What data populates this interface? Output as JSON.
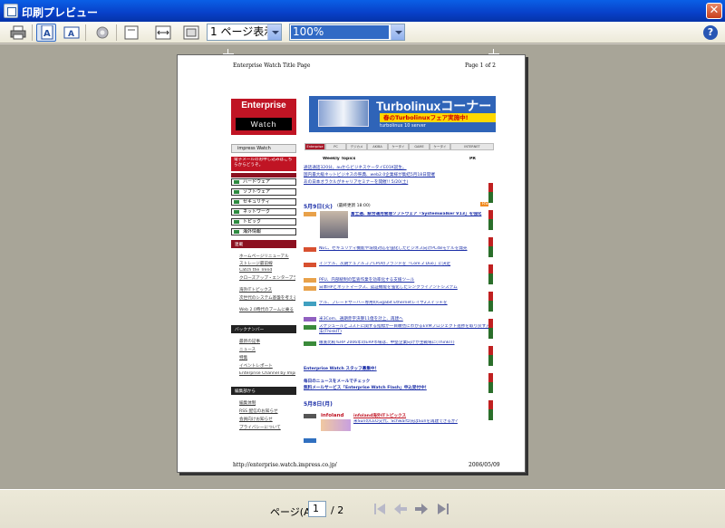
{
  "window": {
    "title": "印刷プレビュー",
    "close_symbol": "✕"
  },
  "toolbar": {
    "buttons": [
      "print-icon",
      "portrait-icon",
      "landscape-icon",
      "page-setup-gear-icon",
      "full-page-icon",
      "page-width-icon",
      "shrink-to-fit-icon"
    ],
    "view_mode": "1 ページ表示",
    "zoom": "100%",
    "help_symbol": "?"
  },
  "page_preview": {
    "header_left": "Enterprise Watch Title Page",
    "header_right": "Page 1 of 2",
    "footer_left": "http://enterprise.watch.impress.co.jp/",
    "footer_right": "2006/05/09",
    "logo_line1": "Enterprise",
    "logo_line2": "Watch",
    "banner_title": "Turbolinuxコーナー",
    "banner_sub": "春のTurbolinuxフェア実施中!",
    "banner_small": "turbolinux 10 server",
    "impress_label": "impress Watch",
    "nav_tabs": [
      "Enterprise",
      "PC",
      "デジカメ",
      "AKIBA",
      "ケータイ",
      "GAME",
      "ケータイ",
      "INTERNET"
    ],
    "weekly_topics": "Weekly Topics",
    "pr": "PR",
    "mail_promo": "電子メールのお申し込みはこちらからどうぞ。",
    "topics": [
      "通話通話320分。auからビジネスケータイE01K誕生。",
      "国内最大級ネットビジネスの祭典、web2.0企業様が集結5月18日開催",
      "あの日本オラクルがキャリアセミナーを開催!! 5/20(土)"
    ],
    "side_menu": [
      "ハードウェア",
      "ソフトウェア",
      "セキュリティ",
      "ネットワーク",
      "トピック",
      "海外情報"
    ],
    "feature_heading": "連載",
    "feature_links": [
      "ホームページリニューアル",
      "ストレージ最前線",
      "Catch the Trend",
      "クローズアップ・エンタープライズ",
      "海外ITトピックス",
      "次世代のシステム基盤を考える",
      "Web 2.0時代のブームに乗る"
    ],
    "backnumber_heading": "バックナンバー",
    "backnumber_links": [
      "最新の記事",
      "ニュース",
      "特集",
      "イベントレポート",
      "Enterprise Channel by Impress TV"
    ],
    "editor_heading": "編集部から",
    "editor_links": [
      "編集体制",
      "RSS 配信のお知らせ",
      "会員向けお知らせ",
      "プライバシーについて"
    ],
    "date1": "5月9日(火)",
    "updated": "(最終更新 18:00)",
    "rss": "RSS",
    "headline": "富士通、統合運用管理ソフトウェア「Systemwalker V13」を強化",
    "news": [
      "NEC、セキュリティ機能や環境対応を強化したビジネス向けPC48モデルを発売",
      "インテル、次期デュアルコアCPUのブランドを「Core 2 Duo」に決定",
      "PFU、内部統制の監査作業を効率化する支援ツール",
      "日本HPとネットマークス、認証機能を強化したシンクライアントシステム",
      "デル、ブレードサーバー専用のGigabit Ethernetレイヤ2スイッチを",
      "米3Com、通期赤字決算11億を計上、再建へ",
      "スケジュールとコストに関する指標が一目瞭然にわかるEVMプロジェクト進捗を取り戻す方法(ThinkIT)",
      "徹底比較!ERP 2006年のERP市場は、中堅企業向けが主戦場に(ThinkIT)"
    ],
    "staff_wanted": "Enterprise Watch スタッフ募集中!",
    "mail_news1": "毎日のニュースをメールでチェック",
    "mail_news2": "無料メールサービス「Enterprise Watch Flash」申込受付中!",
    "date2": "5月8日(月)",
    "infoland_brand": "infoland",
    "infoland_title": "infoland海外ITトピックス",
    "infoland_text": "米SunのCEO交代、Schwartz氏はSunを再建できるか?"
  },
  "statusbar": {
    "page_label": "ページ(A)",
    "page_value": "1",
    "total": "/ 2"
  }
}
